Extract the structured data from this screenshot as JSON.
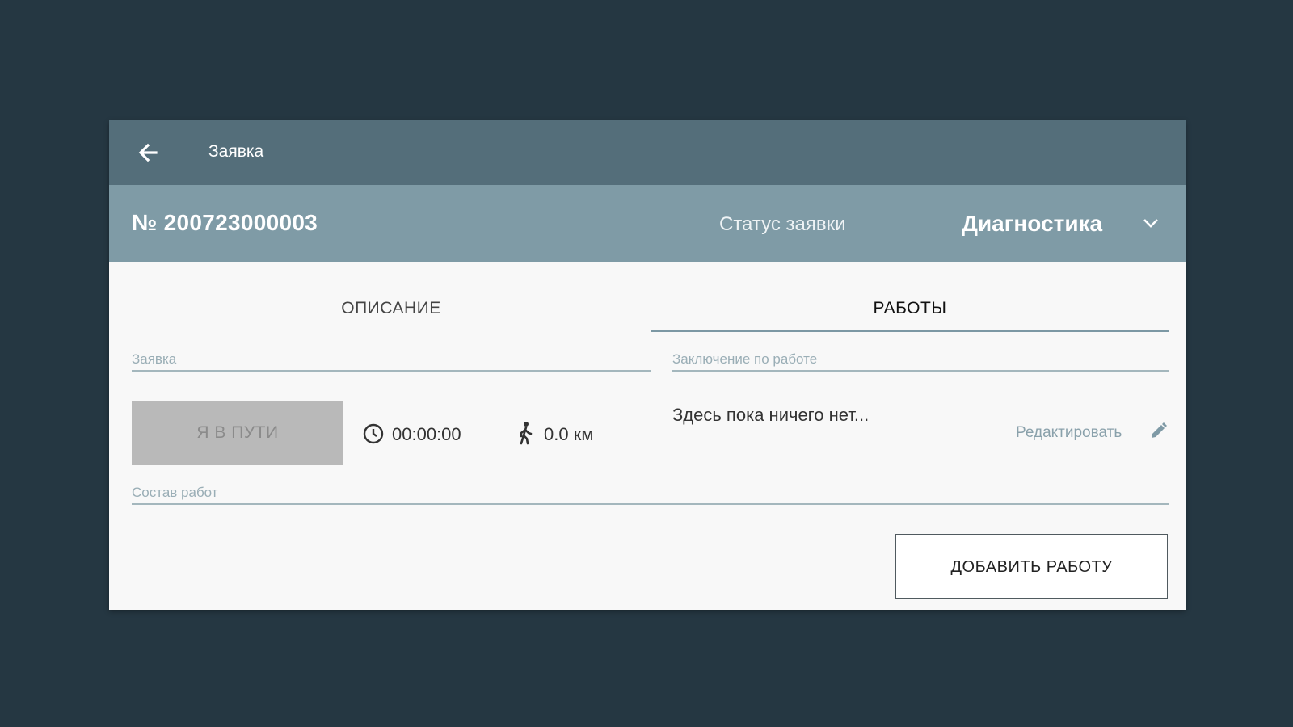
{
  "appbar": {
    "title": "Заявка"
  },
  "order": {
    "number": "№ 200723000003",
    "status_label": "Статус заявки",
    "status_value": "Диагностика"
  },
  "tabs": [
    {
      "label": "ОПИСАНИЕ",
      "active": false
    },
    {
      "label": "РАБОТЫ",
      "active": true
    }
  ],
  "description": {
    "request_label": "Заявка",
    "on_way_button": "Я В ПУТИ",
    "timer": "00:00:00",
    "distance": "0.0 км",
    "works_composition_label": "Состав работ"
  },
  "works": {
    "conclusion_label": "Заключение по работе",
    "empty_text": "Здесь пока ничего нет...",
    "edit_label": "Редактировать",
    "add_work_button": "ДОБАВИТЬ РАБОТУ"
  },
  "icons": {
    "back": "arrow-left-icon",
    "dropdown": "chevron-down-icon",
    "timer": "clock-icon",
    "distance": "walking-person-icon",
    "edit": "pencil-icon"
  },
  "colors": {
    "background": "#253742",
    "appbar": "#546e7a",
    "subheader": "#7f9ba6",
    "tab_indicator": "#7c98a4",
    "disabled_button": "#b9b9b9"
  }
}
